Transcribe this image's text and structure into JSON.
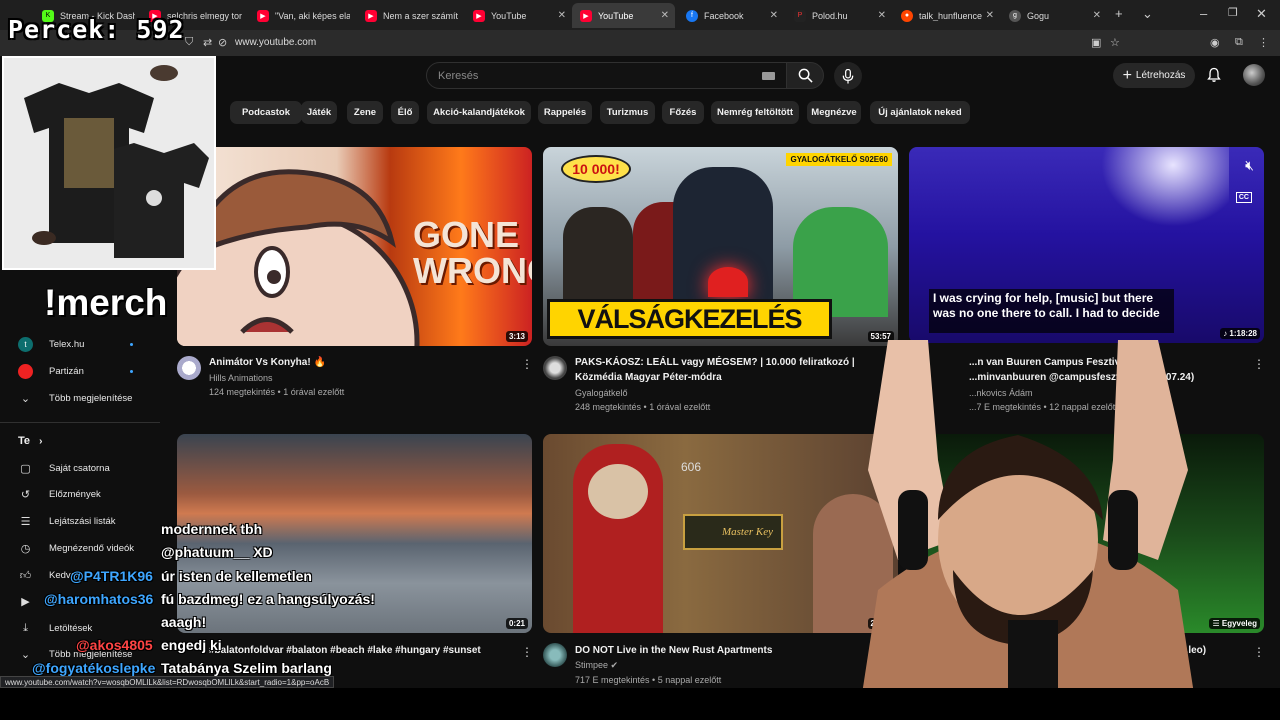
{
  "browser": {
    "tabs": [
      {
        "label": "Stream - Kick Dashb",
        "color": "#53fc18",
        "icon": "k"
      },
      {
        "label": "selchris elmegy tort",
        "color": "#ff0033",
        "icon": "yt"
      },
      {
        "label": "\"Van, aki képes elad",
        "color": "#ff0033",
        "icon": "yt"
      },
      {
        "label": "Nem a szer számít, h",
        "color": "#ff0033",
        "icon": "yt"
      },
      {
        "label": "YouTube",
        "color": "#ff0033",
        "icon": "yt"
      },
      {
        "label": "YouTube",
        "color": "#ff0033",
        "icon": "yt"
      },
      {
        "label": "Facebook",
        "color": "#1877f2",
        "icon": "f"
      },
      {
        "label": "Polod.hu",
        "color": "#222222",
        "icon": "p"
      },
      {
        "label": "talk_hunfluencers",
        "color": "#ff4500",
        "icon": "r"
      },
      {
        "label": "Gogu",
        "color": "#444444",
        "icon": "g"
      }
    ],
    "url": "www.youtube.com",
    "status_url": "www.youtube.com/watch?v=wosqbOMLlLk&list=RDwosqbOMLlLk&start_radio=1&pp=oAcB"
  },
  "overlay": {
    "counter_label": "Percek:",
    "counter_value": "592",
    "merch_command": "!merch"
  },
  "header": {
    "search_placeholder": "Keresés",
    "create_label": "Létrehozás"
  },
  "chips": [
    "Podcastok",
    "Játék",
    "Zene",
    "Élő",
    "Akció-kalandjátékok",
    "Rappelés",
    "Turizmus",
    "Főzés",
    "Nemrég feltöltött",
    "Megnézve",
    "Új ajánlatok neked"
  ],
  "sidebar": {
    "subs": [
      {
        "label": "Telex.hu"
      },
      {
        "label": "Partizán"
      }
    ],
    "more_label": "Több megjelenítése",
    "you_label": "Te",
    "you_items": [
      {
        "label": "Saját csatorna",
        "icon": "channel-icon"
      },
      {
        "label": "Előzmények",
        "icon": "history-icon"
      },
      {
        "label": "Lejátszási listák",
        "icon": "playlist-icon"
      },
      {
        "label": "Megnézendő videók",
        "icon": "watch-later-icon"
      },
      {
        "label": "Kedvelt",
        "icon": "like-icon"
      },
      {
        "label": "Filmek",
        "icon": "movies-icon"
      },
      {
        "label": "Letöltések",
        "icon": "download-icon"
      },
      {
        "label": "Több megjelenítése",
        "icon": "chevron-down-icon"
      }
    ]
  },
  "videos": [
    {
      "title": "Animátor Vs Konyha! 🔥",
      "title2": "",
      "channel": "Hills Animations",
      "meta": "124 megtekintés • 1 órával ezelőtt",
      "duration": "3:13",
      "thumb_text": "GONE WRONG"
    },
    {
      "title": "PAKS-KÁOSZ: LEÁLL vagy MÉGSEM? | 10.000 feliratkozó |",
      "title2": "Közmédia Magyar Péter-módra",
      "channel": "Gyalogátkelő",
      "meta": "248 megtekintés • 1 órával ezelőtt",
      "duration": "53:57",
      "thumb_text": "VÁLSÁGKEZELÉS",
      "thumb_badge": "10 000!",
      "thumb_tag": "GYALOGÁTKELŐ S02E60"
    },
    {
      "title": "...n van Buuren Campus  Fesztiv...",
      "title2": "...minvanbuuren @campusfesztiv... ...026.07.24)",
      "channel": "...nkovics Ádám",
      "meta": "...7 E megtekintés • 12 nappal ezelőtt",
      "duration": "1:18:28",
      "caption": "I was crying for help, [music] but there was no one there to call. I had to decide"
    },
    {
      "title": "#balatonfoldvar #balaton #beach #lake #hungary #sunset",
      "title2": "",
      "channel": "",
      "meta": "",
      "duration": "0:21"
    },
    {
      "title": "DO NOT Live in the New Rust Apartments",
      "title2": "",
      "channel": "Stimpee",
      "meta": "717 E megtekintés • 5 nappal ezelőtt",
      "duration": "20:29",
      "thumb_text": "Master Key",
      "thumb_num": "606"
    },
    {
      "title": "...leo)",
      "title2": "",
      "channel": "",
      "meta": "",
      "duration": "Egyveleg"
    }
  ],
  "chat": [
    {
      "user": "",
      "text": "modernnek tbh"
    },
    {
      "user": "",
      "text": "@phatuum__ XD"
    },
    {
      "user": "",
      "text": "úr isten de kellemetlen"
    },
    {
      "user": "",
      "text": "fú bazdmeg! ez a hangsúlyozás!"
    },
    {
      "user": "",
      "text": "aaagh!"
    },
    {
      "user": "",
      "text": "engedj ki"
    },
    {
      "user": "",
      "text": "Tatabánya Szelim barlang"
    },
    {
      "user": "@P4TR1K96",
      "text": ""
    },
    {
      "user": "@haromhatos36",
      "text": ""
    },
    {
      "user": "@akos4805",
      "text": ""
    },
    {
      "user": "@fogyatékoslepke",
      "text": ""
    }
  ]
}
